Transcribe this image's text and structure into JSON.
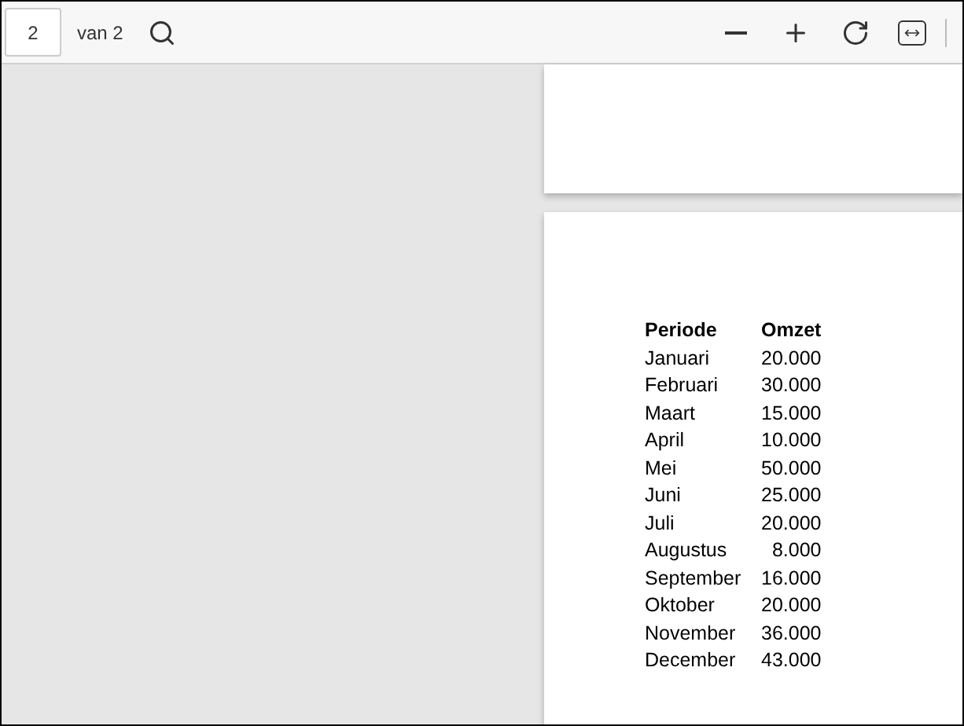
{
  "toolbar": {
    "page_number": "2",
    "page_count": "van 2"
  },
  "table": {
    "columns": [
      "Periode",
      "Omzet"
    ],
    "rows": [
      [
        "Januari",
        "20.000"
      ],
      [
        "Februari",
        "30.000"
      ],
      [
        "Maart",
        "15.000"
      ],
      [
        "April",
        "10.000"
      ],
      [
        "Mei",
        "50.000"
      ],
      [
        "Juni",
        "25.000"
      ],
      [
        "Juli",
        "20.000"
      ],
      [
        "Augustus",
        "8.000"
      ],
      [
        "September",
        "16.000"
      ],
      [
        "Oktober",
        "20.000"
      ],
      [
        "November",
        "36.000"
      ],
      [
        "December",
        "43.000"
      ]
    ]
  }
}
